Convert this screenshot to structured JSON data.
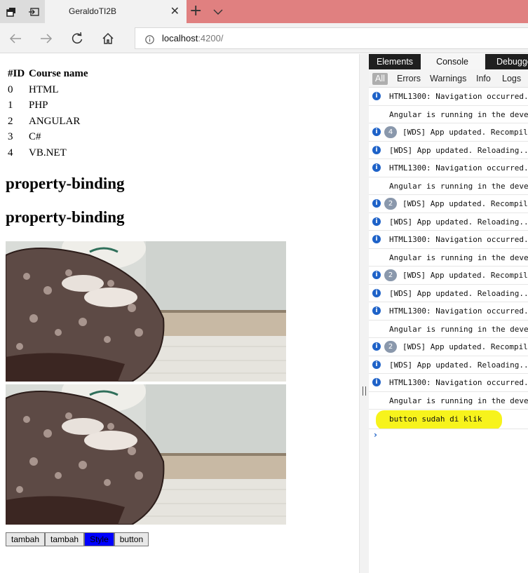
{
  "browser": {
    "tab_title": "GeraldoTI2B",
    "address_host": "localhost",
    "address_port": ":4200/"
  },
  "page": {
    "table": {
      "headers": [
        "#ID",
        "Course name"
      ],
      "rows": [
        [
          "0",
          "HTML"
        ],
        [
          "1",
          "PHP"
        ],
        [
          "2",
          "ANGULAR"
        ],
        [
          "3",
          "C#"
        ],
        [
          "4",
          "VB.NET"
        ]
      ]
    },
    "heading_1": "property-binding",
    "heading_2": "property-binding",
    "buttons": [
      "tambah",
      "tambah",
      "Style",
      "button"
    ],
    "style_button_color": "#0000ff"
  },
  "devtools": {
    "tabs": [
      "Elements",
      "Console",
      "Debugger"
    ],
    "filters": [
      "All",
      "Errors",
      "Warnings",
      "Info",
      "Logs"
    ],
    "logs": [
      {
        "icon": true,
        "count": null,
        "text": "HTML1300: Navigation occurred."
      },
      {
        "icon": false,
        "count": null,
        "text": "Angular is running in the development mode."
      },
      {
        "icon": true,
        "count": "4",
        "text": "[WDS] App updated. Recompiling..."
      },
      {
        "icon": true,
        "count": null,
        "text": "[WDS] App updated. Reloading..."
      },
      {
        "icon": true,
        "count": null,
        "text": "HTML1300: Navigation occurred."
      },
      {
        "icon": false,
        "count": null,
        "text": "Angular is running in the development mode."
      },
      {
        "icon": true,
        "count": "2",
        "text": "[WDS] App updated. Recompiling..."
      },
      {
        "icon": true,
        "count": null,
        "text": "[WDS] App updated. Reloading..."
      },
      {
        "icon": true,
        "count": null,
        "text": "HTML1300: Navigation occurred."
      },
      {
        "icon": false,
        "count": null,
        "text": "Angular is running in the development mode."
      },
      {
        "icon": true,
        "count": "2",
        "text": "[WDS] App updated. Recompiling..."
      },
      {
        "icon": true,
        "count": null,
        "text": "[WDS] App updated. Reloading..."
      },
      {
        "icon": true,
        "count": null,
        "text": "HTML1300: Navigation occurred."
      },
      {
        "icon": false,
        "count": null,
        "text": "Angular is running in the development mode."
      },
      {
        "icon": true,
        "count": "2",
        "text": "[WDS] App updated. Recompiling..."
      },
      {
        "icon": true,
        "count": null,
        "text": "[WDS] App updated. Reloading..."
      },
      {
        "icon": true,
        "count": null,
        "text": "HTML1300: Navigation occurred."
      },
      {
        "icon": false,
        "count": null,
        "text": "Angular is running in the development mode."
      },
      {
        "icon": false,
        "count": null,
        "text": "button sudah di klik",
        "highlight": true
      }
    ],
    "highlight_color": "#f7f31c",
    "info_icon_color": "#1e62c8"
  }
}
